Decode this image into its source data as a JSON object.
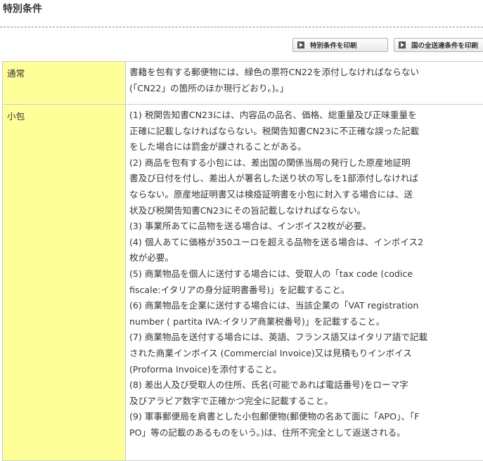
{
  "section": {
    "title": "特別条件"
  },
  "buttons": {
    "print_special": {
      "label": "特別条件を印刷",
      "icon": "arrow-right-icon"
    },
    "print_all": {
      "label": "国の全送達条件を印刷",
      "icon": "arrow-right-icon"
    }
  },
  "rows": [
    {
      "header": "通常",
      "lines": [
        "書籍を包有する郵便物には、緑色の票符CN22を添付しなければならない",
        "(「CN22」の箇所のほか現行どおり。)。」"
      ]
    },
    {
      "header": "小包",
      "lines": [
        "(1) 税関告知書CN23には、内容品の品名、価格、総重量及び正味重量を",
        "正確に記載しなければならない。税関告知書CN23に不正確な誤った記載",
        "をした場合には罰金が課されることがある。",
        "(2) 商品を包有する小包には、差出国の関係当局の発行した原産地証明",
        "書及び日付を付し、差出人が署名した送り状の写しを1部添付しなければ",
        "ならない。原産地証明書又は検疫証明書を小包に封入する場合には、送",
        "状及び税関告知書CN23にその旨記載しなければならない。",
        "(3) 事業所あてに品物を送る場合は、インボイス2枚が必要。",
        "(4) 個人あてに価格が350ユーロを超える品物を送る場合は、インボイス2",
        "枚が必要。",
        "(5) 商業物品を個人に送付する場合には、受取人の「tax code (codice",
        "fiscale:イタリアの身分証明書番号)」を記載すること。",
        "(6) 商業物品を企業に送付する場合には、当該企業の「VAT registration",
        "number ( partita IVA:イタリア商業税番号)」を記載すること。",
        "(7) 商業物品を送付する場合には、英語、フランス語又はイタリア語で記載",
        "された商業インボイス (Commercial Invoice)又は見積もりインボイス",
        "(Proforma Invoice)を添付すること。",
        "(8) 差出人及び受取人の住所、氏名(可能であれば電話番号)をローマ字",
        "及びアラビア数字で正確かつ完全に記載すること。",
        "(9) 軍事郵便局を肩書とした小包郵便物(郵便物の名あて面に「APO」、「F",
        "PO」等の記載のあるものをいう。)は、住所不完全として返送される。"
      ]
    }
  ]
}
